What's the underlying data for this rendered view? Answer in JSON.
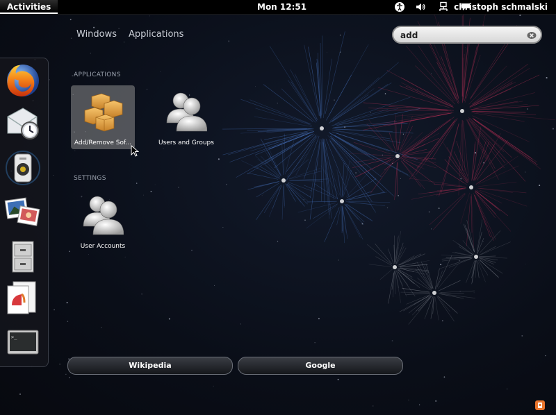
{
  "topbar": {
    "activities_label": "Activities",
    "clock": "Mon 12:51",
    "user_name": "christoph schmalski",
    "tray_icons": [
      "accessibility-icon",
      "volume-icon",
      "network-icon",
      "user-status-icon"
    ]
  },
  "overview": {
    "tabs": [
      "Windows",
      "Applications"
    ],
    "search": {
      "value": "add"
    }
  },
  "dash": {
    "items": [
      "firefox-icon",
      "evolution-mail-icon",
      "rhythmbox-icon",
      "shotwell-icon",
      "file-manager-icon",
      "libreoffice-impress-icon",
      "terminal-icon"
    ]
  },
  "results": {
    "applications_header": "APPLICATIONS",
    "applications": [
      {
        "label": "Add/Remove Sof...",
        "icon": "software-packages-icon",
        "selected": true
      },
      {
        "label": "Users and Groups",
        "icon": "users-icon",
        "selected": false
      }
    ],
    "settings_header": "SETTINGS",
    "settings": [
      {
        "label": "User Accounts",
        "icon": "users-icon"
      }
    ]
  },
  "search_providers": [
    "Wikipedia",
    "Google"
  ],
  "colors": {
    "topbar": "#000000",
    "selected_tile": "#8c8c8c",
    "firework_blue": "#4a78c8",
    "firework_red": "#c8325a"
  }
}
